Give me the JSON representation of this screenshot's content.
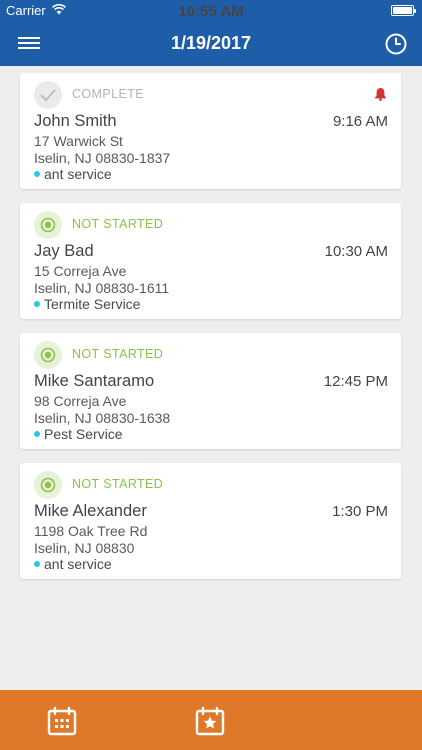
{
  "status_bar": {
    "carrier": "Carrier",
    "time": "10:55 AM"
  },
  "header": {
    "title": "1/19/2017"
  },
  "appointments": [
    {
      "status": "COMPLETE",
      "status_type": "complete",
      "has_alert": true,
      "name": "John Smith",
      "time": "9:16 AM",
      "address1": "17 Warwick St",
      "address2": "Iselin, NJ 08830-1837",
      "service": "ant service"
    },
    {
      "status": "NOT STARTED",
      "status_type": "not-started",
      "has_alert": false,
      "name": "Jay Bad",
      "time": "10:30 AM",
      "address1": "15 Correja Ave",
      "address2": "Iselin, NJ 08830-1611",
      "service": "Termite Service"
    },
    {
      "status": "NOT STARTED",
      "status_type": "not-started",
      "has_alert": false,
      "name": "Mike Santaramo",
      "time": "12:45 PM",
      "address1": "98 Correja Ave",
      "address2": "Iselin, NJ 08830-1638",
      "service": "Pest Service"
    },
    {
      "status": "NOT STARTED",
      "status_type": "not-started",
      "has_alert": false,
      "name": "Mike Alexander",
      "time": "1:30 PM",
      "address1": "1198 Oak Tree Rd",
      "address2": "Iselin, NJ 08830",
      "service": "ant service"
    }
  ],
  "colors": {
    "header": "#1e5ea9",
    "footer": "#e0782a",
    "not_started": "#8bc34a",
    "alert": "#d0342c",
    "service_dot": "#29c7e3"
  },
  "footer": {
    "tabs": [
      "calendar-icon",
      "calendar-star-icon"
    ]
  }
}
